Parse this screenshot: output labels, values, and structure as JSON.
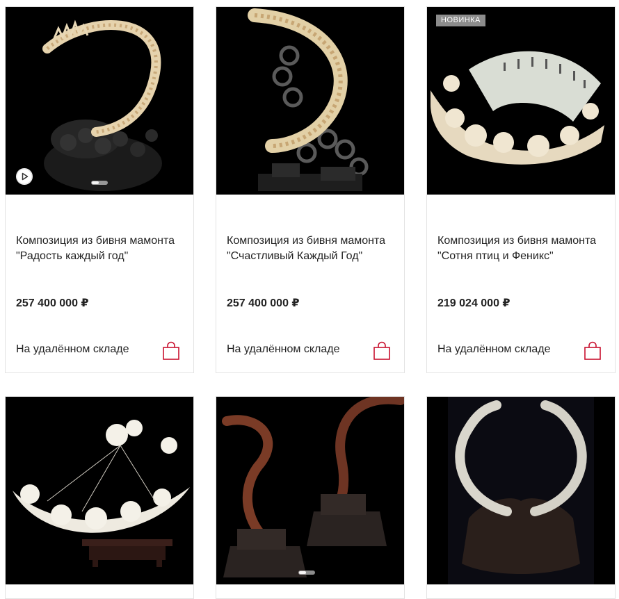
{
  "products": [
    {
      "title": "Композиция из бивня мамонта \"Радость каждый год\"",
      "price": "257 400 000 ₽",
      "availability": "На удалённом складе",
      "has_video": true,
      "badge": ""
    },
    {
      "title": "Композиция из бивня мамонта \"Счастливый Каждый Год\"",
      "price": "257 400 000 ₽",
      "availability": "На удалённом складе",
      "has_video": false,
      "badge": ""
    },
    {
      "title": "Композиция из бивня мамонта \"Сотня птиц и Феникс\"",
      "price": "219 024 000 ₽",
      "availability": "На удалённом складе",
      "has_video": false,
      "badge": "НОВИНКА"
    }
  ],
  "icons": {
    "cart": "shopping-bag-icon",
    "video": "play-icon"
  },
  "colors": {
    "accent": "#c8102e",
    "badge_bg": "#8c8c8c",
    "text": "#222222",
    "card_border": "#e3e3e3",
    "photo_bg": "#000000"
  }
}
